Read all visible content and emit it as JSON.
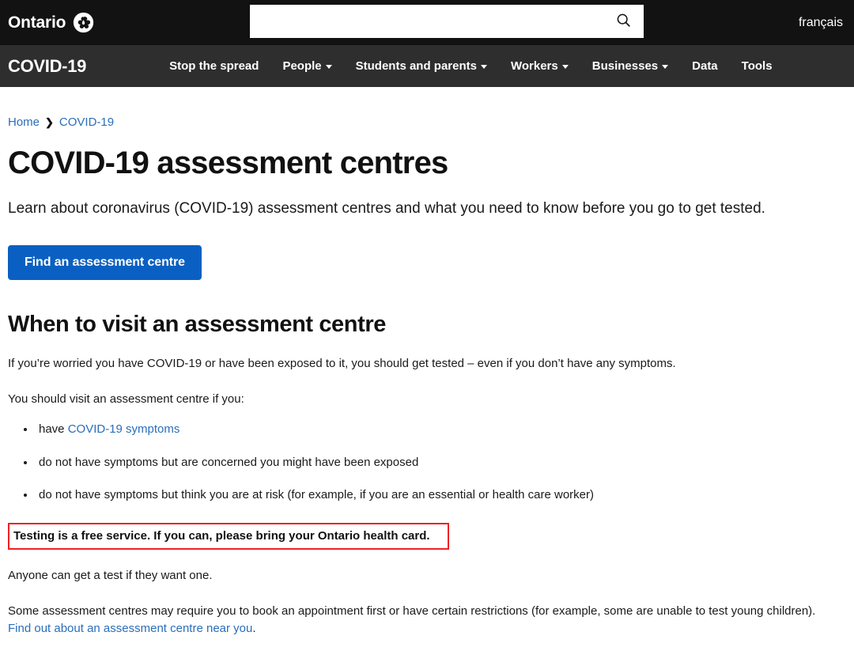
{
  "header": {
    "brand_word": "Ontario",
    "brand_icon": "trillium-logo-icon",
    "search": {
      "value": "",
      "placeholder": "",
      "icon": "search-icon"
    },
    "language_link": "français"
  },
  "nav": {
    "title": "COVID-19",
    "items": [
      {
        "label": "Stop the spread",
        "has_dropdown": false
      },
      {
        "label": "People",
        "has_dropdown": true
      },
      {
        "label": "Students and parents",
        "has_dropdown": true
      },
      {
        "label": "Workers",
        "has_dropdown": true
      },
      {
        "label": "Businesses",
        "has_dropdown": true
      },
      {
        "label": "Data",
        "has_dropdown": false
      },
      {
        "label": "Tools",
        "has_dropdown": false
      }
    ]
  },
  "breadcrumb": {
    "home": "Home",
    "separator": "❯",
    "current": "COVID-19"
  },
  "main": {
    "page_title": "COVID-19 assessment centres",
    "lede": "Learn about coronavirus (COVID-19) assessment centres and what you need to know before you go to get tested.",
    "cta_label": "Find an assessment centre",
    "section_title": "When to visit an assessment centre",
    "paragraph_1": "If you’re worried you have COVID-19 or have been exposed to it, you should get tested – even if you don’t have any symptoms.",
    "paragraph_2": "You should visit an assessment centre if you:",
    "bullets": [
      {
        "prefix": "have ",
        "link": "COVID-19 symptoms",
        "suffix": ""
      },
      {
        "prefix": "do not have symptoms but are concerned you might have been exposed",
        "link": "",
        "suffix": ""
      },
      {
        "prefix": "do not have symptoms but think you are at risk (for example, if you are an essential or health care worker)",
        "link": "",
        "suffix": ""
      }
    ],
    "highlight_text": "Testing is a free service. If you can, please bring your Ontario health card.",
    "paragraph_3": "Anyone can get a test if they want one.",
    "paragraph_4_prefix": "Some assessment centres may require you to book an appointment first or have certain restrictions (for example, some are unable to test young children). ",
    "paragraph_4_link": "Find out about an assessment centre near you",
    "paragraph_4_suffix": "."
  },
  "colors": {
    "topbar_bg": "#121212",
    "navbar_bg": "#2e2e2e",
    "link_blue": "#2a6ebb",
    "cta_blue": "#0a60c2",
    "highlight_border": "#ee2222",
    "text": "#1a1a1a"
  }
}
